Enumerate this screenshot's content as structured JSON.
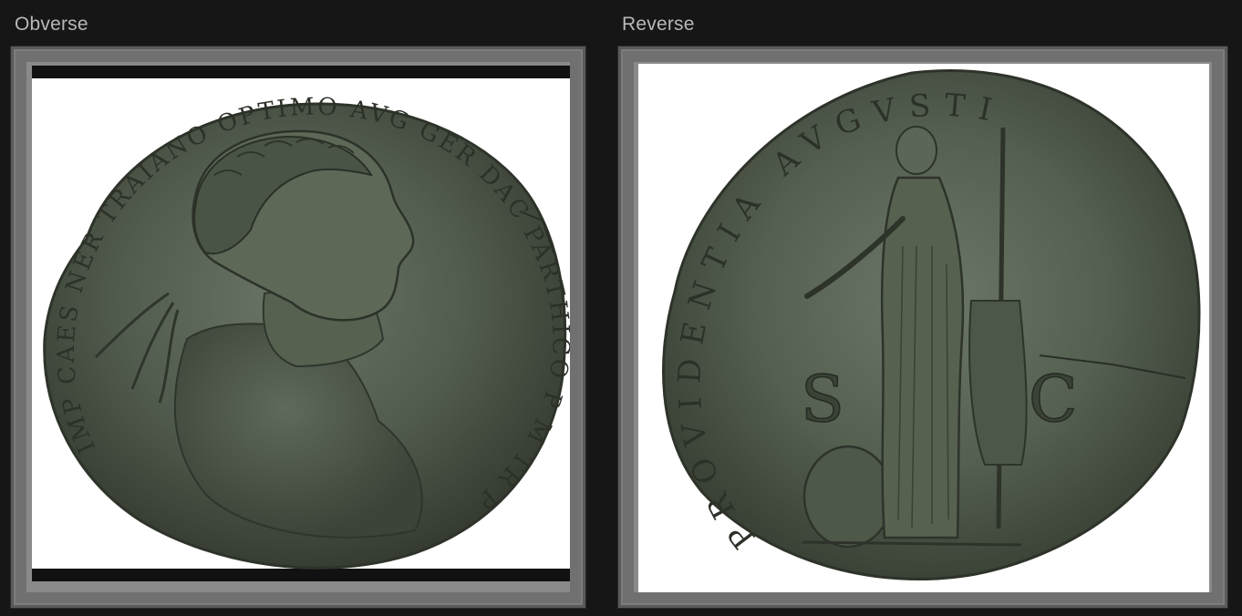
{
  "obverse": {
    "label": "Obverse",
    "legend": "IMP CAES NER TRAIANO OPTIMO AVG GER DAC PARTHICO P M TR P COS VI P P"
  },
  "reverse": {
    "label": "Reverse",
    "legend": "PROVIDENTIA AVGVSTI"
  },
  "colors": {
    "background": "#161616",
    "frame": "#707070",
    "coin_patina": "#4d5a4a",
    "coin_edge": "#3a3f35"
  }
}
